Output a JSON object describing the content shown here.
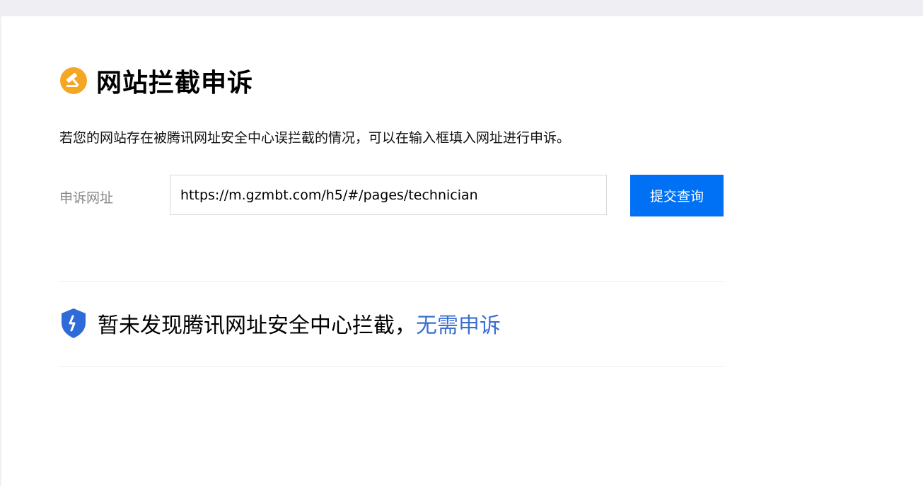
{
  "page": {
    "title": "网站拦截申诉",
    "title_icon": "gavel-icon",
    "description": "若您的网站存在被腾讯网址安全中心误拦截的情况，可以在输入框填入网址进行申诉。"
  },
  "form": {
    "label": "申诉网址",
    "url_value": "https://m.gzmbt.com/h5/#/pages/technician",
    "submit_label": "提交查询"
  },
  "result": {
    "icon": "shield-icon",
    "message": "暂未发现腾讯网址安全中心拦截，",
    "link_text": "无需申诉"
  },
  "colors": {
    "accent": "#0071f4",
    "link": "#3b6fd1",
    "title_icon": "#f5a623",
    "shield": "#2f6bd8"
  }
}
